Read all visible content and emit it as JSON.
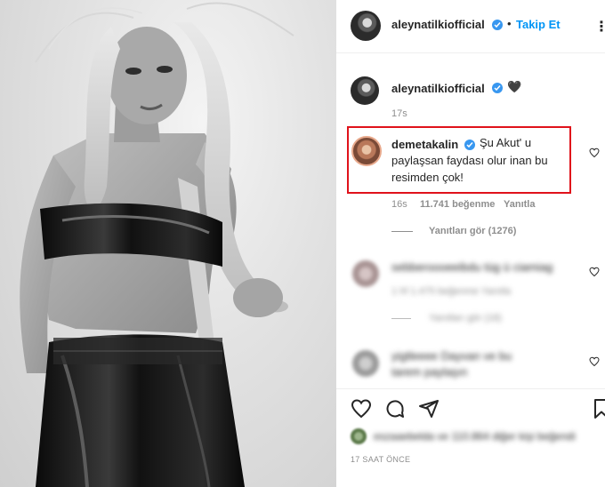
{
  "header": {
    "username": "aleynatilkiofficial",
    "follow_separator": "•",
    "follow_label": "Takip Et",
    "more_label": "⋮"
  },
  "caption": {
    "username": "aleynatilkiofficial",
    "emoji": "🖤",
    "time": "17s"
  },
  "highlighted_comment": {
    "username": "demetakalin",
    "text_line1": "Şu Akut' u",
    "text_line2": "paylaşsan faydası olur inan bu",
    "text_line3": "resimden çok!",
    "time": "16s",
    "likes": "11.741 beğenme",
    "reply_label": "Yanıtla",
    "view_replies": "Yanıtları gör (1276)",
    "highlight_color": "#e0121b"
  },
  "blurred_comments": [
    {
      "line1": "sebberoooeeibdu tüg ü ciamiag",
      "meta": "1 hf   1.475 beğenme   Yanıtla",
      "view_replies": "Yanıtları gör (18)"
    },
    {
      "line1": "yigtleeee Dayvan ve bu",
      "line2": "tarem paylaşın",
      "meta": ""
    }
  ],
  "likes_line": "eszaaebelda ve 110.864 diğer kişi beğendi",
  "timestamp": "17 SAAT ÖNCE",
  "colors": {
    "accent": "#0095f6",
    "verified": "#3897f0",
    "muted": "#8e8e8e",
    "text": "#262626"
  },
  "icons": [
    "heart-icon",
    "comment-icon",
    "share-icon",
    "bookmark-icon",
    "verified-badge-icon"
  ]
}
